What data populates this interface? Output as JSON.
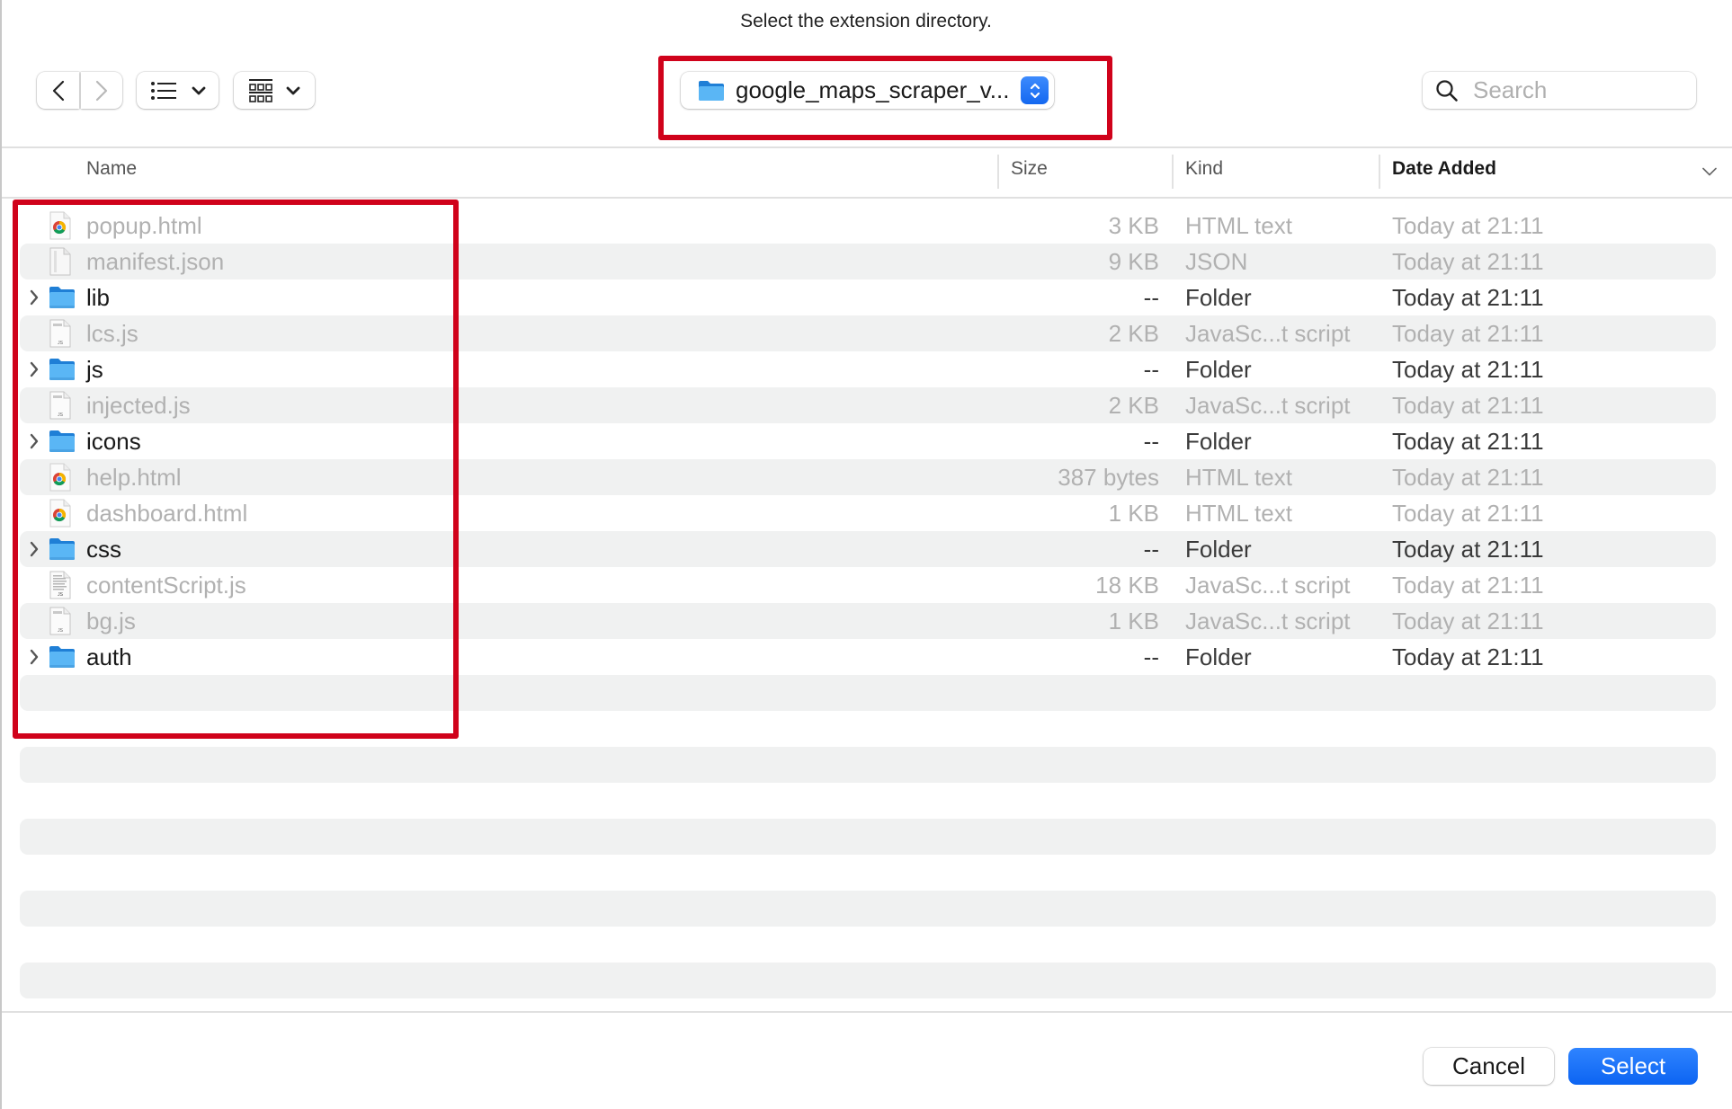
{
  "dialog": {
    "prompt": "Select the extension directory."
  },
  "toolbar": {
    "back_icon": "chevron-left-icon",
    "forward_icon": "chevron-right-icon",
    "view_mode_icon": "list-view-icon",
    "group_icon": "group-grid-icon",
    "location": {
      "label": "google_maps_scraper_v...",
      "icon": "folder-icon"
    },
    "search": {
      "placeholder": "Search",
      "value": ""
    }
  },
  "columns": {
    "name": "Name",
    "size": "Size",
    "kind": "Kind",
    "date_added": "Date Added",
    "sort_column": "Date Added",
    "sort_direction": "descending"
  },
  "files": [
    {
      "name": "popup.html",
      "size": "3 KB",
      "kind": "HTML text",
      "date_added": "Today at 21:11",
      "type": "html",
      "enabled": false
    },
    {
      "name": "manifest.json",
      "size": "9 KB",
      "kind": "JSON",
      "date_added": "Today at 21:11",
      "type": "json",
      "enabled": false
    },
    {
      "name": "lib",
      "size": "--",
      "kind": "Folder",
      "date_added": "Today at 21:11",
      "type": "folder",
      "enabled": true
    },
    {
      "name": "lcs.js",
      "size": "2 KB",
      "kind": "JavaSc...t script",
      "date_added": "Today at 21:11",
      "type": "js",
      "enabled": false
    },
    {
      "name": "js",
      "size": "--",
      "kind": "Folder",
      "date_added": "Today at 21:11",
      "type": "folder",
      "enabled": true
    },
    {
      "name": "injected.js",
      "size": "2 KB",
      "kind": "JavaSc...t script",
      "date_added": "Today at 21:11",
      "type": "js",
      "enabled": false
    },
    {
      "name": "icons",
      "size": "--",
      "kind": "Folder",
      "date_added": "Today at 21:11",
      "type": "folder",
      "enabled": true
    },
    {
      "name": "help.html",
      "size": "387 bytes",
      "kind": "HTML text",
      "date_added": "Today at 21:11",
      "type": "html",
      "enabled": false
    },
    {
      "name": "dashboard.html",
      "size": "1 KB",
      "kind": "HTML text",
      "date_added": "Today at 21:11",
      "type": "html",
      "enabled": false
    },
    {
      "name": "css",
      "size": "--",
      "kind": "Folder",
      "date_added": "Today at 21:11",
      "type": "folder",
      "enabled": true
    },
    {
      "name": "contentScript.js",
      "size": "18 KB",
      "kind": "JavaSc...t script",
      "date_added": "Today at 21:11",
      "type": "js-doc",
      "enabled": false
    },
    {
      "name": "bg.js",
      "size": "1 KB",
      "kind": "JavaSc...t script",
      "date_added": "Today at 21:11",
      "type": "js",
      "enabled": false
    },
    {
      "name": "auth",
      "size": "--",
      "kind": "Folder",
      "date_added": "Today at 21:11",
      "type": "folder",
      "enabled": true
    }
  ],
  "footer": {
    "cancel_label": "Cancel",
    "select_label": "Select"
  },
  "annotations": {
    "highlight_color": "#d0021b"
  },
  "colors": {
    "accent": "#1468f0",
    "folder": "#5ab6f5",
    "stripe": "#f0f1f1",
    "disabled_text": "#b1b1b1"
  }
}
